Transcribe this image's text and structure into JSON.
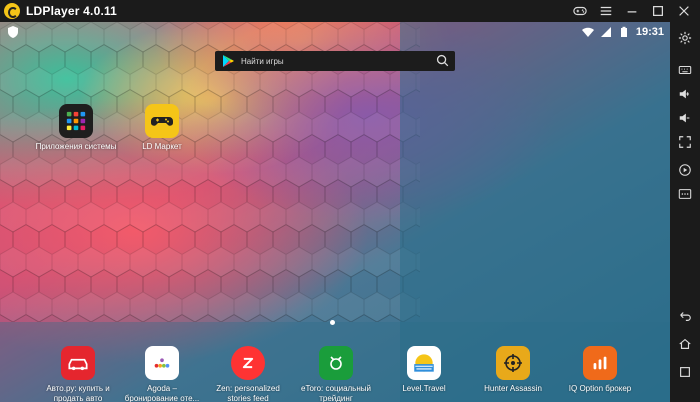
{
  "window": {
    "title": "LDPlayer 4.0.11"
  },
  "status": {
    "time": "19:31"
  },
  "search": {
    "placeholder": "Найти игры"
  },
  "desktop_apps": [
    {
      "label": "Приложения системы",
      "icon": "apps-folder-icon"
    },
    {
      "label": "LD Маркет",
      "icon": "gamepad-icon",
      "color": "#f5c518"
    }
  ],
  "dock_apps": [
    {
      "label": "Авто.ру: купить и\nпродать авто",
      "icon": "autoru-icon",
      "color": "#e5262e"
    },
    {
      "label": "Agoda –\nбронирование оте...",
      "icon": "agoda-icon",
      "color": "#ffffff"
    },
    {
      "label": "Zen: personalized\nstories feed",
      "icon": "zen-icon",
      "color": "#ff3333"
    },
    {
      "label": "eToro: социальный\nтрейдинг",
      "icon": "etoro-icon",
      "color": "#1a9d3b"
    },
    {
      "label": "Level.Travel",
      "icon": "level-travel-icon",
      "color": "#2f8fdc"
    },
    {
      "label": "Hunter Assassin",
      "icon": "hunter-assassin-icon",
      "color": "#e8a91a"
    },
    {
      "label": "IQ Option брокер",
      "icon": "iq-option-icon",
      "color": "#f06a1a"
    }
  ]
}
